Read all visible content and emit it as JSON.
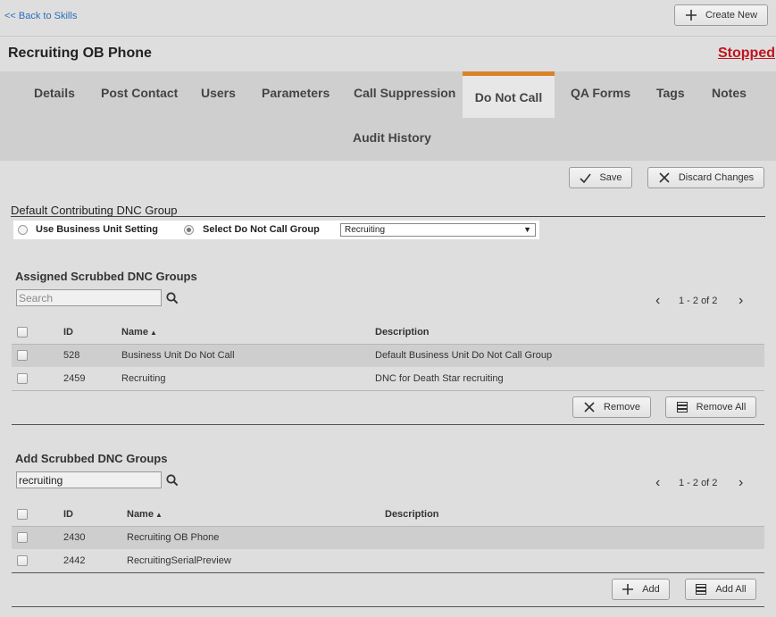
{
  "topbar": {
    "back_link": "<< Back to Skills",
    "create_new": "Create New"
  },
  "header": {
    "title": "Recruiting OB Phone",
    "status": "Stopped"
  },
  "tabs": [
    "Details",
    "Post Contact",
    "Users",
    "Parameters",
    "Call Suppression",
    "Do Not Call",
    "QA Forms",
    "Tags",
    "Notes",
    "Audit History"
  ],
  "active_tab": "Do Not Call",
  "actions": {
    "save": "Save",
    "discard": "Discard Changes"
  },
  "default_group": {
    "label": "Default Contributing DNC Group",
    "option_business_unit": "Use Business Unit Setting",
    "option_select": "Select Do Not Call Group",
    "selected_option": "Select Do Not Call Group",
    "select_value": "Recruiting"
  },
  "assigned": {
    "title": "Assigned Scrubbed DNC Groups",
    "search_placeholder": "Search",
    "search_value": "",
    "pager": "1 - 2 of 2",
    "columns": {
      "id": "ID",
      "name": "Name",
      "description": "Description"
    },
    "rows": [
      {
        "id": "528",
        "name": "Business Unit Do Not Call",
        "description": "Default Business Unit Do Not Call Group"
      },
      {
        "id": "2459",
        "name": "Recruiting",
        "description": "DNC for Death Star recruiting"
      }
    ],
    "remove": "Remove",
    "remove_all": "Remove All"
  },
  "add": {
    "title": "Add Scrubbed DNC Groups",
    "search_value": "recruiting",
    "pager": "1 - 2 of 2",
    "columns": {
      "id": "ID",
      "name": "Name",
      "description": "Description"
    },
    "rows": [
      {
        "id": "2430",
        "name": "Recruiting OB Phone",
        "description": ""
      },
      {
        "id": "2442",
        "name": "RecruitingSerialPreview",
        "description": ""
      }
    ],
    "add": "Add",
    "add_all": "Add All"
  },
  "colors": {
    "accent": "#d9822b",
    "status": "#c0141e",
    "link": "#2a6ebb"
  }
}
